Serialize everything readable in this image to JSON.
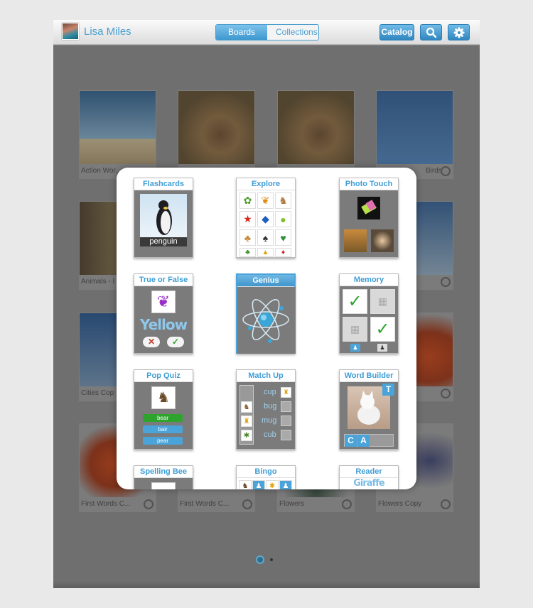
{
  "user": {
    "name": "Lisa Miles"
  },
  "tabs": [
    {
      "label": "Boards",
      "active": true
    },
    {
      "label": "Collections",
      "active": false
    }
  ],
  "toolbar": {
    "catalog_label": "Catalog",
    "search_icon": "search-icon",
    "settings_icon": "gear-icon"
  },
  "colors": {
    "accent": "#4a9fcf",
    "tile_blue": "#4aa3d9",
    "correct_green": "#2ea32e"
  },
  "boards": [
    {
      "label": "Action Wor..."
    },
    {
      "label": ""
    },
    {
      "label": ""
    },
    {
      "label": "Birds"
    },
    {
      "label": "Animals - I"
    },
    {
      "label": ""
    },
    {
      "label": "Cities Cop"
    },
    {
      "label": ""
    },
    {
      "label": "First Words C..."
    },
    {
      "label": "First Words C..."
    },
    {
      "label": "Flowers"
    },
    {
      "label": "Flowers Copy"
    }
  ],
  "activities": [
    {
      "title": "Flashcards",
      "caption": "penguin"
    },
    {
      "title": "Explore"
    },
    {
      "title": "Photo Touch"
    },
    {
      "title": "True or False",
      "word": "Yellow"
    },
    {
      "title": "Genius",
      "selected": true
    },
    {
      "title": "Memory"
    },
    {
      "title": "Pop Quiz",
      "options": [
        "bear",
        "bair",
        "pear"
      ]
    },
    {
      "title": "Match Up",
      "words": [
        "cup",
        "bug",
        "mug",
        "cub"
      ]
    },
    {
      "title": "Word Builder",
      "letters": [
        "C",
        "A"
      ],
      "top_letter": "T"
    },
    {
      "title": "Spelling Bee"
    },
    {
      "title": "Bingo"
    },
    {
      "title": "Reader",
      "word": "Giraffe"
    }
  ],
  "pager": {
    "pages": 2,
    "current": 1
  }
}
